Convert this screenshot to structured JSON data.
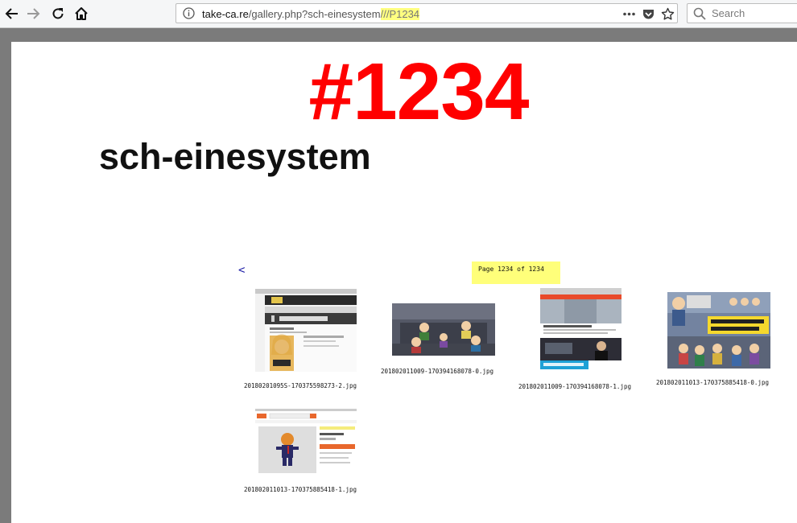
{
  "browser": {
    "url": {
      "domain": "take-ca.re",
      "path": "/gallery.php?sch-einesystem",
      "highlight": "///P1234"
    },
    "search": {
      "placeholder": "Search"
    },
    "icons": {
      "back": "back-arrow-icon",
      "forward": "forward-arrow-icon",
      "reload": "reload-icon",
      "home": "home-icon",
      "info": "info-icon",
      "more": "more-dots-icon",
      "pocket": "pocket-icon",
      "bookmark": "star-icon",
      "search": "search-icon"
    }
  },
  "page": {
    "number": "#1234",
    "title": "sch-einesystem",
    "prev_label": "<",
    "page_indicator": "Page 1234 of 1234",
    "colors": {
      "number": "#ff0000",
      "indicator": "#ffff7a",
      "link": "#1a1aa6"
    }
  },
  "gallery": [
    {
      "caption": "20180201095S-170375598273-2.jpg"
    },
    {
      "caption": "201802011009-170394168078-0.jpg"
    },
    {
      "caption": "201802011009-170394168078-1.jpg"
    },
    {
      "caption": "201802011013-170375885418-0.jpg"
    },
    {
      "caption": "201802011013-170375885418-1.jpg"
    }
  ]
}
